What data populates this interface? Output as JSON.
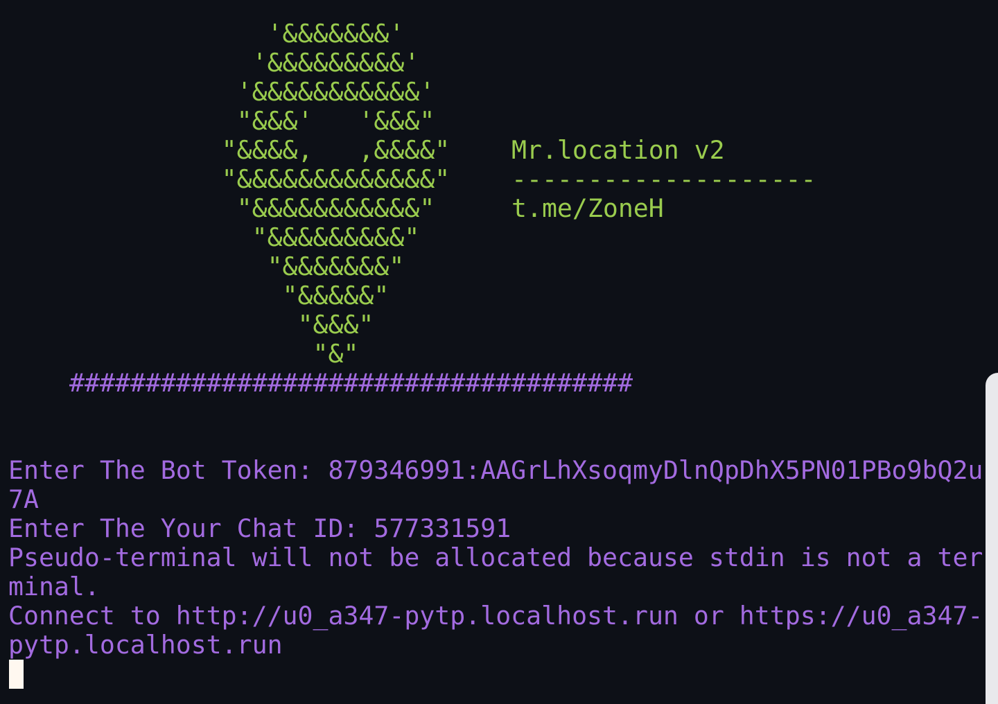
{
  "banner": {
    "art": [
      "                 '&&&&&&&'",
      "                '&&&&&&&&&'",
      "               '&&&&&&&&&&&'",
      "               \"&&&'   '&&&\"",
      "              \"&&&&,   ,&&&&\"",
      "              \"&&&&&&&&&&&&&\"",
      "               \"&&&&&&&&&&&\"",
      "                \"&&&&&&&&&\"",
      "                 \"&&&&&&&\"",
      "                  \"&&&&&\"",
      "                   \"&&&\"",
      "                    \"&\""
    ],
    "title": "Mr.location v2",
    "divider": "--------------------",
    "link": "t.me/ZoneH",
    "hash_rule": "#####################################"
  },
  "output": {
    "lines": [
      "Enter The Bot Token: 879346991:AAGrLhXsoqmyDlnQpDhX5PN01PBo9bQ2u",
      "7A",
      "Enter The Your Chat ID: 577331591",
      "Pseudo-terminal will not be allocated because stdin is not a ter",
      "minal.",
      "Connect to http://u0_a347-pytp.localhost.run or https://u0_a347-",
      "pytp.localhost.run"
    ]
  },
  "colors": {
    "background": "#0d1017",
    "banner_text": "#9acc4e",
    "output_text": "#a36be0",
    "cursor": "#fff8f0"
  }
}
